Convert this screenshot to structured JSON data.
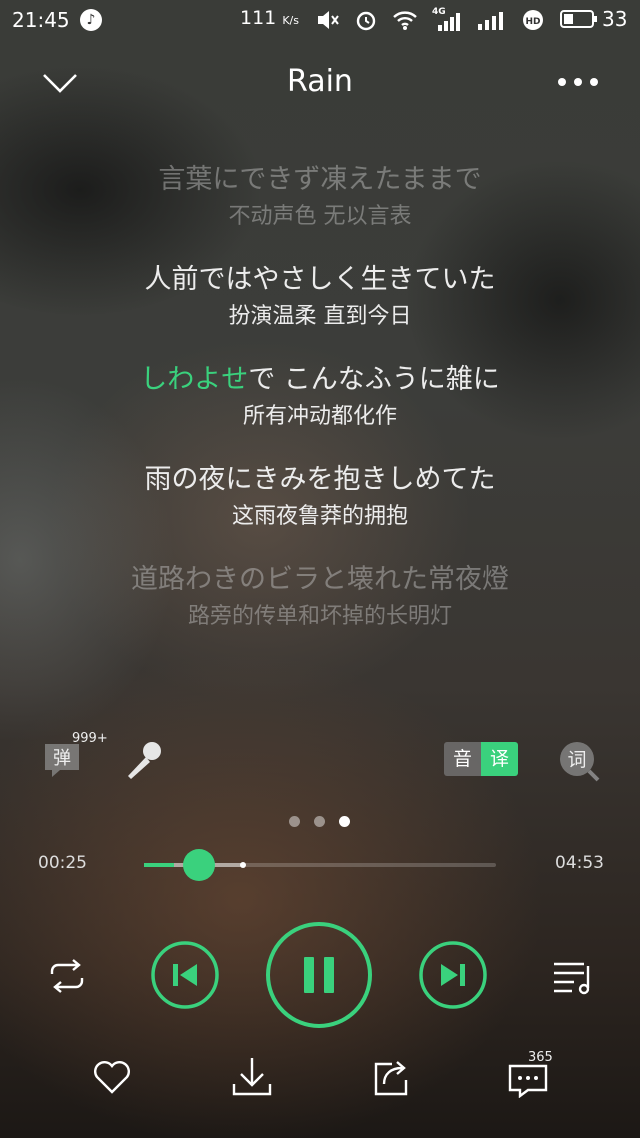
{
  "status_bar": {
    "time": "21:45",
    "notification_icon": "music-note-icon",
    "speed": "111",
    "speed_unit": "K/s",
    "network_label": "4G",
    "battery": "33"
  },
  "header": {
    "title": "Rain",
    "back_icon": "chevron-down-icon",
    "more_icon": "more-dots-icon"
  },
  "lyrics": [
    {
      "jp": "言葉にできず凍えたままで",
      "cn": "不动声色 无以言表",
      "state": "past"
    },
    {
      "jp": "人前ではやさしく生きていた",
      "cn": "扮演温柔 直到今日",
      "state": "normal"
    },
    {
      "jp_highlight": "しわよせ",
      "jp_rest": "で こんなふうに雑に",
      "cn": "所有冲动都化作",
      "state": "current"
    },
    {
      "jp": "雨の夜にきみを抱きしめてた",
      "cn": "这雨夜鲁莽的拥抱",
      "state": "normal"
    },
    {
      "jp": "道路わきのビラと壊れた常夜燈",
      "cn": "路旁的传单和坏掉的长明灯",
      "state": "upcoming"
    }
  ],
  "tools": {
    "danmu_label": "弹",
    "danmu_count": "999+",
    "trans_original": "音",
    "trans_translated": "译",
    "lyrics_search_label": "词"
  },
  "pager": {
    "count": 3,
    "active": 3
  },
  "progress": {
    "current": "00:25",
    "total": "04:53",
    "played_fraction": 0.086,
    "buffered_fraction": 0.28
  },
  "controls": {
    "loop_icon": "repeat-icon",
    "prev_icon": "skip-previous-icon",
    "play_icon": "pause-icon",
    "next_icon": "skip-next-icon",
    "playlist_icon": "playlist-icon"
  },
  "bottom": {
    "like_icon": "heart-icon",
    "download_icon": "download-icon",
    "share_icon": "share-icon",
    "comment_icon": "comment-icon",
    "comment_count": "365"
  },
  "colors": {
    "accent": "#3ad17d"
  }
}
